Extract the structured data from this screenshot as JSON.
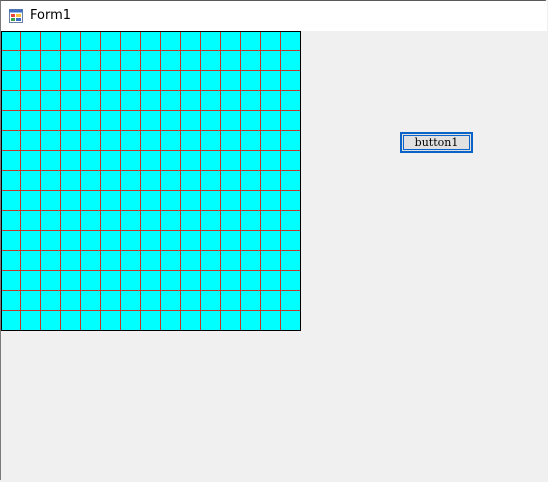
{
  "window": {
    "title": "Form1",
    "icon": "winforms-app-icon"
  },
  "grid": {
    "rows": 15,
    "columns": 15,
    "cell_color": "#00ffff",
    "line_color": "#c0392b",
    "border_color": "#000000"
  },
  "buttons": {
    "button1_label": "button1"
  }
}
